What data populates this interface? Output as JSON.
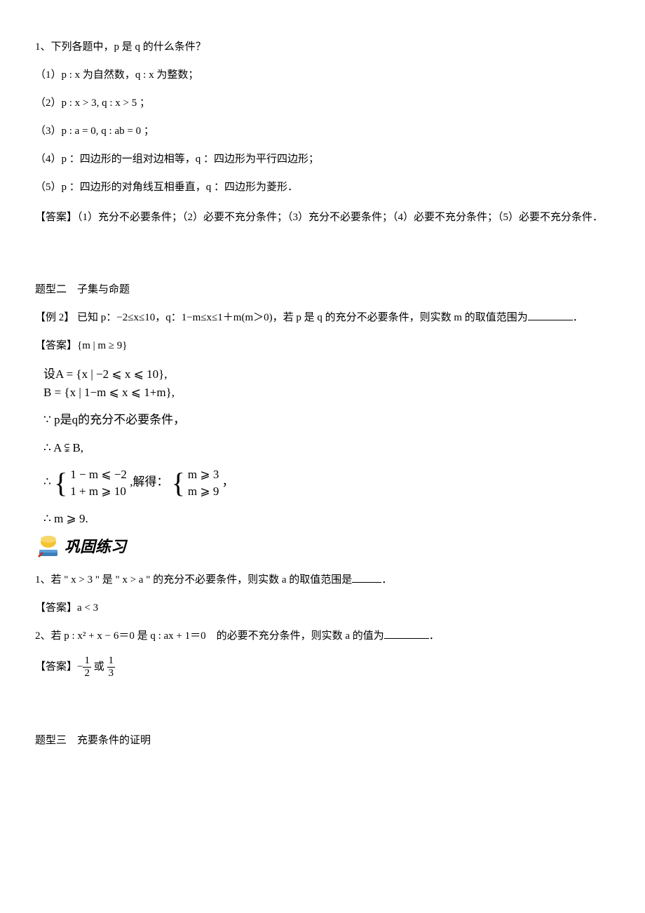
{
  "q1": {
    "stem": "1、下列各题中，p 是 q 的什么条件？",
    "opt1": "（1）p : x 为自然数，q : x 为整数；",
    "opt2": "（2）p : x > 3, q : x > 5 ；",
    "opt3": "（3）p : a = 0, q : ab = 0 ；",
    "opt4": "（4）p ：四边形的一组对边相等，q ：四边形为平行四边形；",
    "opt5": "（5）p ：四边形的对角线互相垂直，q ：四边形为菱形．",
    "answer": "【答案】（1）充分不必要条件；（2）必要不充分条件；（3）充分不必要条件；（4）必要不充分条件；（5）必要不充分条件．"
  },
  "section2": {
    "title": "题型二　子集与命题",
    "ex_label": "【例 2】",
    "ex_body_a": "已知 p：−2≤x≤10，q：1−m≤x≤1＋m(m＞0)，若 p 是 q 的充分不必要条件，则实数 m 的取值范围为",
    "ex_body_b": "．",
    "ans_label": "【答案】",
    "ans_val": "{m | m ≥ 9}",
    "sol1a": "设A = {x | −2 ⩽ x ⩽ 10},",
    "sol1b": "B = {x | 1−m ⩽ x ⩽ 1+m},",
    "sol2": "∵ p是q的充分不必要条件，",
    "sol3": "∴ A ⫋ B,",
    "sol4_pre": "∴",
    "sol4_r1": "1 − m ⩽ −2",
    "sol4_r2": "1 + m ⩾ 10",
    "sol4_mid": ",解得：",
    "sol4_s1": "m ⩾ 3",
    "sol4_s2": "m ⩾ 9",
    "sol4_suf": "，",
    "sol5": "∴ m ⩾ 9."
  },
  "practice_label": "巩固练习",
  "p1": {
    "body_a": "1、若 \" x > 3 \" 是 \" x > a \" 的充分不必要条件，则实数 a 的取值范围是",
    "body_b": "．",
    "ans_label": "【答案】",
    "ans_val": "a < 3"
  },
  "p2": {
    "body_a": "2、若 p : x² + x − 6＝0 是 q : ax + 1＝0　的必要不充分条件，则实数 a 的值为",
    "body_b": "．",
    "ans_label": "【答案】",
    "frac1_num": "1",
    "frac1_den": "2",
    "mid": " 或 ",
    "frac2_num": "1",
    "frac2_den": "3",
    "neg": "−"
  },
  "section3": {
    "title": "题型三　充要条件的证明"
  }
}
